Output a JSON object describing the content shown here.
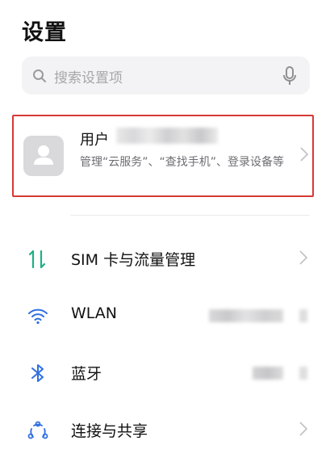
{
  "header": {
    "title": "设置"
  },
  "search": {
    "placeholder": "搜索设置项"
  },
  "account": {
    "name_prefix": "用户",
    "subtitle": "管理“云服务”、“查找手机”、登录设备等"
  },
  "settings": [
    {
      "label": "SIM 卡与流量管理",
      "icon": "sim-data-icon"
    },
    {
      "label": "WLAN",
      "icon": "wifi-icon"
    },
    {
      "label": "蓝牙",
      "icon": "bluetooth-icon"
    },
    {
      "label": "连接与共享",
      "icon": "connection-share-icon"
    }
  ],
  "colors": {
    "highlight_border": "#d63a35",
    "accent_blue": "#2f6fe0",
    "sim_green": "#1fae86"
  }
}
